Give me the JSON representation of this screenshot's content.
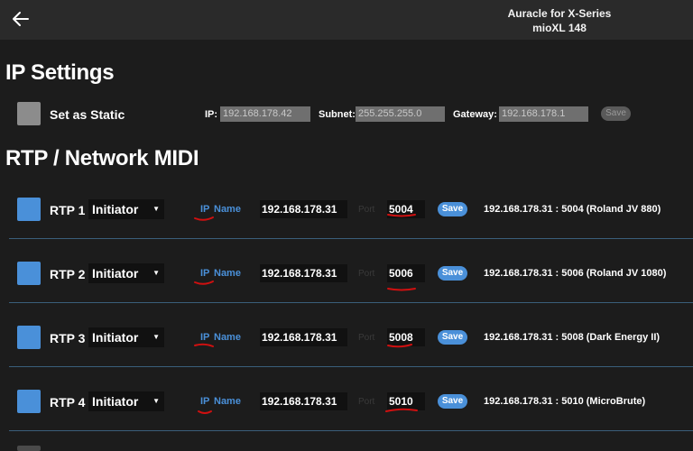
{
  "header": {
    "back_icon": "arrow-left-icon",
    "title_line1": "Auracle for X-Series",
    "title_line2": "mioXL 148"
  },
  "ip_settings": {
    "title": "IP Settings",
    "static_label": "Set as Static",
    "ip_label": "IP:",
    "ip_value": "192.168.178.42",
    "subnet_label": "Subnet:",
    "subnet_value": "255.255.255.0",
    "gateway_label": "Gateway:",
    "gateway_value": "192.168.178.1",
    "save_label": "Save"
  },
  "rtp": {
    "title": "RTP / Network MIDI",
    "colors": {
      "accent": "#4a90d9",
      "annotation": "#d01010"
    },
    "rows": [
      {
        "label": "RTP 1",
        "mode": "Initiator",
        "ip_toggle": "IP",
        "name_toggle": "Name",
        "address": "192.168.178.31",
        "port_label": "Port",
        "port": "5004",
        "save": "Save",
        "status": "192.168.178.31 : 5004 (Roland JV 880)"
      },
      {
        "label": "RTP 2",
        "mode": "Initiator",
        "ip_toggle": "IP",
        "name_toggle": "Name",
        "address": "192.168.178.31",
        "port_label": "Port",
        "port": "5006",
        "save": "Save",
        "status": "192.168.178.31 : 5006 (Roland JV 1080)"
      },
      {
        "label": "RTP 3",
        "mode": "Initiator",
        "ip_toggle": "IP",
        "name_toggle": "Name",
        "address": "192.168.178.31",
        "port_label": "Port",
        "port": "5008",
        "save": "Save",
        "status": "192.168.178.31 : 5008 (Dark Energy II)"
      },
      {
        "label": "RTP 4",
        "mode": "Initiator",
        "ip_toggle": "IP",
        "name_toggle": "Name",
        "address": "192.168.178.31",
        "port_label": "Port",
        "port": "5010",
        "save": "Save",
        "status": "192.168.178.31 : 5010 (MicroBrute)"
      }
    ]
  }
}
